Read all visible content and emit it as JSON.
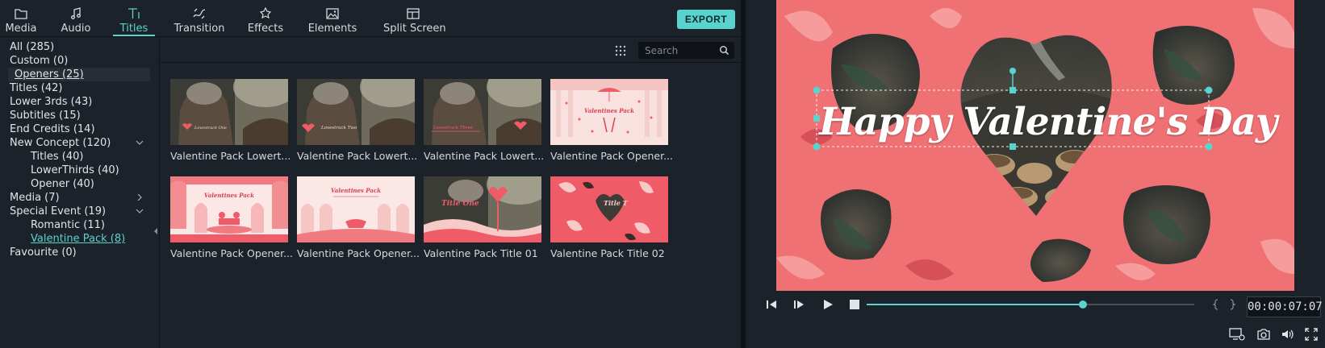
{
  "toolbar": {
    "tabs": [
      {
        "label": "Media",
        "icon": "folder-icon"
      },
      {
        "label": "Audio",
        "icon": "music-note-icon"
      },
      {
        "label": "Titles",
        "icon": "title-text-icon"
      },
      {
        "label": "Transition",
        "icon": "transition-icon"
      },
      {
        "label": "Effects",
        "icon": "effects-icon"
      },
      {
        "label": "Elements",
        "icon": "image-icon"
      },
      {
        "label": "Split Screen",
        "icon": "split-screen-icon"
      }
    ],
    "active_tab": "Titles",
    "export_label": "EXPORT"
  },
  "sidebar": {
    "items": [
      {
        "label": "All (285)"
      },
      {
        "label": "Custom (0)"
      },
      {
        "label": "Openers (25)",
        "state": "selected"
      },
      {
        "label": "Titles (42)"
      },
      {
        "label": "Lower 3rds (43)"
      },
      {
        "label": "Subtitles (15)"
      },
      {
        "label": "End Credits (14)"
      },
      {
        "label": "New Concept (120)",
        "expanded": true
      },
      {
        "label": "Titles (40)",
        "level": 2
      },
      {
        "label": "LowerThirds (40)",
        "level": 2
      },
      {
        "label": "Opener (40)",
        "level": 2
      },
      {
        "label": "Media (7)",
        "expanded": false
      },
      {
        "label": "Special Event (19)",
        "expanded": true
      },
      {
        "label": "Romantic (11)",
        "level": 2
      },
      {
        "label": "Valentine Pack (8)",
        "level": 2,
        "state": "active"
      },
      {
        "label": "Favourite (0)"
      }
    ]
  },
  "content": {
    "search_placeholder": "Search",
    "thumbnails": [
      {
        "caption": "Valentine Pack Lowert...",
        "overlay": "Lovestruck One"
      },
      {
        "caption": "Valentine Pack Lowert...",
        "overlay": "Lovestruck Two"
      },
      {
        "caption": "Valentine Pack Lowert...",
        "overlay": "Lovestruck Three"
      },
      {
        "caption": "Valentine Pack Opener...",
        "overlay": "Valentines Pack"
      },
      {
        "caption": "Valentine Pack Opener...",
        "overlay": "Valentines Pack"
      },
      {
        "caption": "Valentine Pack Opener...",
        "overlay": "Valentines Pack"
      },
      {
        "caption": "Valentine Pack Title 01",
        "overlay": "Title One"
      },
      {
        "caption": "Valentine Pack Title 02",
        "overlay": "Title T"
      }
    ]
  },
  "preview": {
    "overlay_text": "Happy Valentine's Day",
    "timecode": "00:00:07:07",
    "progress": 0.66,
    "controls": [
      "step-back-icon",
      "step-forward-icon",
      "play-icon",
      "stop-icon",
      "mark-in-icon",
      "mark-out-icon",
      "render-preview-icon",
      "snapshot-icon",
      "volume-icon",
      "fullscreen-icon"
    ]
  },
  "colors": {
    "accent": "#5ad2cd",
    "panel": "#1c2229",
    "background": "#0f1318",
    "valentine_red": "#ef5b66",
    "valentine_pink": "#f7c9c7"
  }
}
